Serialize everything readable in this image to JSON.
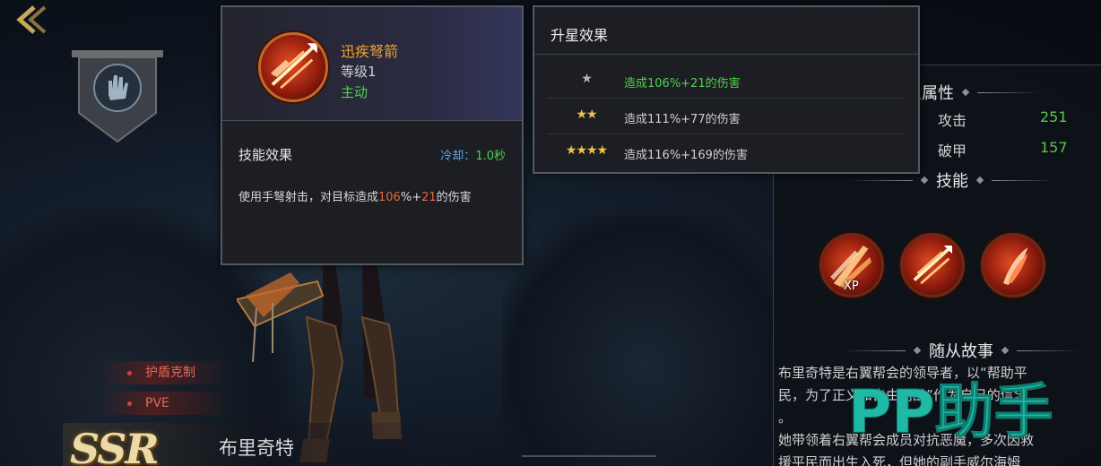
{
  "skill_tooltip": {
    "name": "迅疾弩箭",
    "level": "等级1",
    "type": "主动",
    "effect_title": "技能效果",
    "cooldown_label": "冷却：",
    "cooldown_value": "1.0秒",
    "desc_prefix": "使用手弩射击，对目标造成",
    "desc_pct": "106",
    "desc_mid": "%+",
    "desc_flat": "21",
    "desc_suffix": "的伤害"
  },
  "star_panel": {
    "title": "升星效果",
    "rows": [
      {
        "stars": "★",
        "text": "造成106%+21的伤害",
        "active": true
      },
      {
        "stars": "★★",
        "text": "造成111%+77的伤害",
        "active": false
      },
      {
        "stars": "★★★★",
        "text": "造成116%+169的伤害",
        "active": false
      }
    ]
  },
  "right_panel": {
    "star_attr_title": "星属性",
    "attributes": [
      {
        "label": "攻击",
        "value": "251"
      },
      {
        "label": "破甲",
        "value": "157"
      }
    ],
    "skills_title": "技能",
    "xp_label": "XP",
    "story_title": "随从故事",
    "story_lines": [
      "布里奇特是右翼帮会的领导者，以“帮助平",
      "民，为了正义和自由而战”作为自己的信念",
      "。",
      "她带领着右翼帮会成员对抗恶魔，多次因救",
      "援平民而出生入死，但她的副手威尔海姆"
    ]
  },
  "hero": {
    "rarity": "SSR",
    "name": "布里奇特",
    "tags": [
      "护盾克制",
      "PVE"
    ]
  },
  "watermark": "PP助手",
  "colors": {
    "gold": "#f2a230",
    "green": "#4fd24a",
    "orange": "#e2693a",
    "blue": "#5aa8e6"
  }
}
